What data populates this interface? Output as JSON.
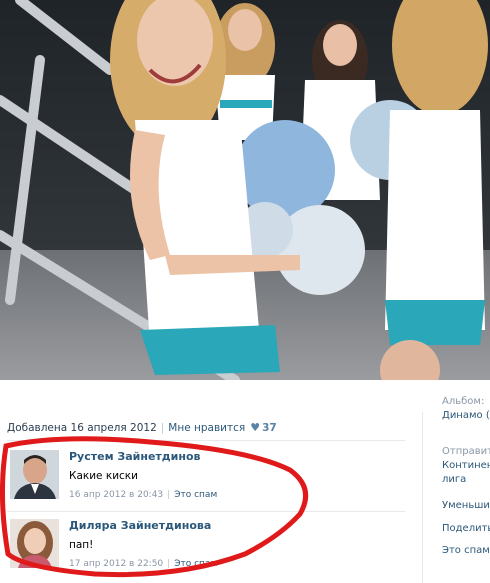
{
  "photo": {
    "description": "cheerleaders-photo"
  },
  "post": {
    "added": "Добавлена 16 апреля 2012",
    "like_label": "Мне нравится",
    "like_count": "37"
  },
  "comments": [
    {
      "author": "Рустем Зайнетдинов",
      "text": "Какие киски",
      "date": "16 апр 2012 в 20:43",
      "spam": "Это спам"
    },
    {
      "author": "Диляра Зайнетдинова",
      "text": "пап!",
      "date": "17 апр 2012 в 22:50",
      "spam": "Это спам"
    }
  ],
  "sidebar": {
    "album_label": "Альбом:",
    "album_value": "Динамо (",
    "sender_label": "Отправит",
    "sender_value_1": "Континен",
    "sender_value_2": "лига",
    "reduce": "Уменьшит",
    "share": "Поделить",
    "spam": "Это спам"
  },
  "colors": {
    "link": "#2b587a",
    "annotation": "#e01a1a"
  }
}
